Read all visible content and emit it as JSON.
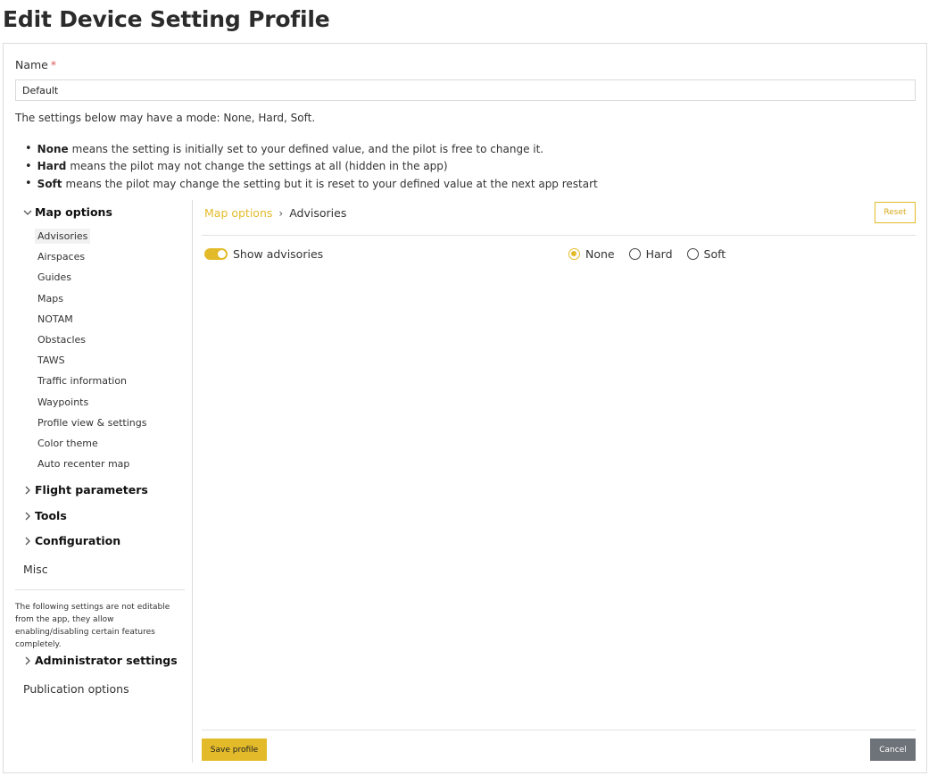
{
  "page": {
    "title": "Edit Device Setting Profile"
  },
  "form": {
    "name_label": "Name",
    "required_mark": "*",
    "name_value": "Default",
    "intro": "The settings below may have a mode: None, Hard, Soft.",
    "modes": [
      {
        "term": "None",
        "desc": "means the setting is initially set to your defined value, and the pilot is free to change it."
      },
      {
        "term": "Hard",
        "desc": "means the pilot may not change the settings at all (hidden in the app)"
      },
      {
        "term": "Soft",
        "desc": "means the pilot may change the setting but it is reset to your defined value at the next app restart"
      }
    ]
  },
  "sidebar": {
    "map_options": {
      "label": "Map options",
      "expanded": true,
      "items": [
        "Advisories",
        "Airspaces",
        "Guides",
        "Maps",
        "NOTAM",
        "Obstacles",
        "TAWS",
        "Traffic information",
        "Waypoints",
        "Profile view & settings",
        "Color theme",
        "Auto recenter map"
      ],
      "active_item": "Advisories"
    },
    "flight_parameters": "Flight parameters",
    "tools": "Tools",
    "configuration": "Configuration",
    "misc": "Misc",
    "note": "The following settings are not editable from the app, they allow enabling/disabling certain features completely.",
    "administrator_settings": "Administrator settings",
    "publication_options": "Publication options"
  },
  "main": {
    "breadcrumb": {
      "parent": "Map options",
      "separator": "›",
      "current": "Advisories"
    },
    "reset_label": "Reset",
    "setting": {
      "label": "Show advisories",
      "enabled": true,
      "modes": [
        "None",
        "Hard",
        "Soft"
      ],
      "selected_mode": "None"
    },
    "save_label": "Save profile",
    "cancel_label": "Cancel"
  },
  "colors": {
    "accent": "#e3bb2a",
    "cancel_bg": "#6e737a",
    "required": "#e05a5a"
  },
  "icons": {
    "expanded": "chevron-down-icon",
    "collapsed": "chevron-right-icon"
  }
}
